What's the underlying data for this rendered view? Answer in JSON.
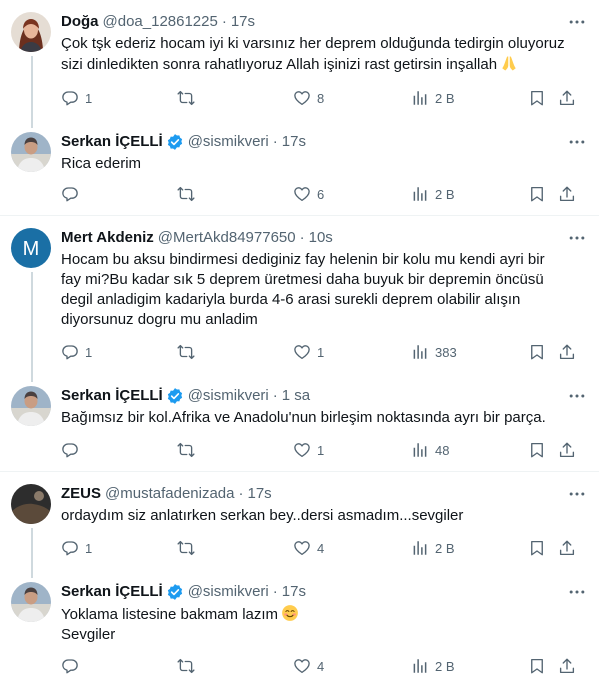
{
  "colors": {
    "text": "#0f1419",
    "secondary": "#536471",
    "verified": "#1d9bf0",
    "thread_line": "#cfd9de",
    "divider": "#eff3f4",
    "mert_avatar": "#1a6fa5"
  },
  "icons": {
    "reply": "speech-bubble-icon",
    "retweet": "retweet-arrows-icon",
    "like": "heart-icon",
    "views": "bar-chart-icon",
    "bookmark": "bookmark-icon",
    "share": "upload-share-icon",
    "more": "more-dots-icon",
    "verified": "verified-badge-icon"
  },
  "tweets": [
    {
      "name": "Doğa",
      "handle": "@doa_12861225",
      "dot": "·",
      "time": "17s",
      "verified": false,
      "lines": [
        "Çok tşk ederiz hocam iyi ki varsınız her deprem olduğunda tedirgin oluyoruz",
        "sizi dinledikten sonra rahatlıyoruz Allah işinizi rast getirsin inşallah"
      ],
      "emoji": "praying-hands-emoji",
      "replies": "1",
      "retweets": "",
      "likes": "8",
      "views": "2 B"
    },
    {
      "name": "Serkan İÇELLİ",
      "handle": "@sismikveri",
      "dot": "·",
      "time": "17s",
      "verified": true,
      "lines": [
        "Rica ederim"
      ],
      "replies": "",
      "retweets": "",
      "likes": "6",
      "views": "2 B"
    },
    {
      "name": "Mert Akdeniz",
      "handle": "@MertAkd84977650",
      "dot": "·",
      "time": "10s",
      "verified": false,
      "avatar_letter": "M",
      "lines": [
        "Hocam bu aksu bindirmesi dediginiz fay helenin bir kolu mu kendi ayri bir",
        "fay mi?Bu kadar sık 5 deprem üretmesi daha buyuk bir depremin öncüsü",
        "degil anladigim kadariyla burda 4-6 arasi surekli deprem olabilir alışın",
        "diyorsunuz dogru mu anladim"
      ],
      "replies": "1",
      "retweets": "",
      "likes": "1",
      "views": "383"
    },
    {
      "name": "Serkan İÇELLİ",
      "handle": "@sismikveri",
      "dot": "·",
      "time": "1 sa",
      "verified": true,
      "lines": [
        "Bağımsız bir kol.Afrika ve Anadolu'nun birleşim noktasında ayrı bir parça."
      ],
      "replies": "",
      "retweets": "",
      "likes": "1",
      "views": "48"
    },
    {
      "name": "ZEUS",
      "handle": "@mustafadenizada",
      "dot": "·",
      "time": "17s",
      "verified": false,
      "lines": [
        "ordaydım siz anlatırken serkan bey..dersi asmadım...sevgiler"
      ],
      "replies": "1",
      "retweets": "",
      "likes": "4",
      "views": "2 B"
    },
    {
      "name": "Serkan İÇELLİ",
      "handle": "@sismikveri",
      "dot": "·",
      "time": "17s",
      "verified": true,
      "lines": [
        "Yoklama listesine bakmam lazım",
        "Sevgiler"
      ],
      "emoji": "smiling-face-emoji",
      "replies": "",
      "retweets": "",
      "likes": "4",
      "views": "2 B"
    }
  ]
}
